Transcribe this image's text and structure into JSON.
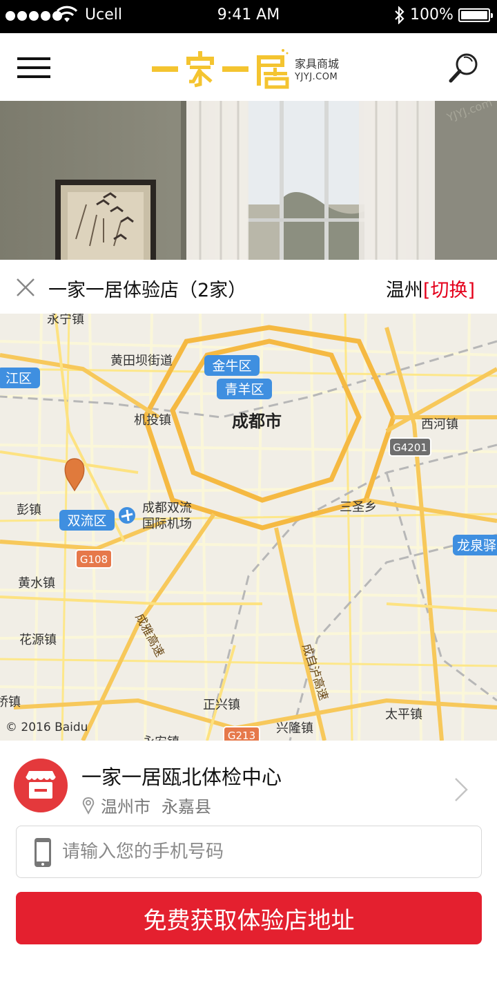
{
  "status_bar": {
    "carrier": "Ucell",
    "time": "9:41 AM",
    "battery": "100%"
  },
  "header": {
    "menu_icon": "hamburger-icon",
    "logo_text": "一家一居",
    "logo_sub1": "家具商城",
    "logo_sub2": "YJYJ.COM",
    "search_icon": "search-icon",
    "accent": "#f4c430"
  },
  "banner": {
    "watermark": "YJYJ.com"
  },
  "store_bar": {
    "title": "一家一居体验店（2家）",
    "city": "温州",
    "switch_label": "[切换]",
    "accent": "#e4001b"
  },
  "map": {
    "labels": {
      "yongning": "永宁镇",
      "huangtianba": "黄田坝街道",
      "jiangqu": "江区",
      "jinniu": "金牛区",
      "qingyang": "青羊区",
      "jitou": "机投镇",
      "chengdu": "成都市",
      "xihe": "西河镇",
      "g4201": "G4201",
      "pengzhen": "彭镇",
      "shuangliu": "双流区",
      "airport1": "成都双流",
      "airport2": "国际机场",
      "sansheng": "三圣乡",
      "longquan": "龙泉驿",
      "g108": "G108",
      "huangshui": "黄水镇",
      "chengya": "成雅高速",
      "chengzilu": "成自泸高速",
      "huayuan": "花源镇",
      "zhengxing": "正兴镇",
      "xinglong": "兴隆镇",
      "taiping": "太平镇",
      "qiaozhen": "桥镇",
      "yongan": "永安镇",
      "g213": "G213",
      "copyright": "© 2016 Baidu"
    }
  },
  "store_item": {
    "name": "一家一居瓯北体检中心",
    "city": "温州市",
    "district": "永嘉县",
    "color": "#e4393c"
  },
  "form": {
    "phone_placeholder": "请输入您的手机号码",
    "submit_label": "免费获取体验店地址",
    "button_color": "#e4202f"
  }
}
